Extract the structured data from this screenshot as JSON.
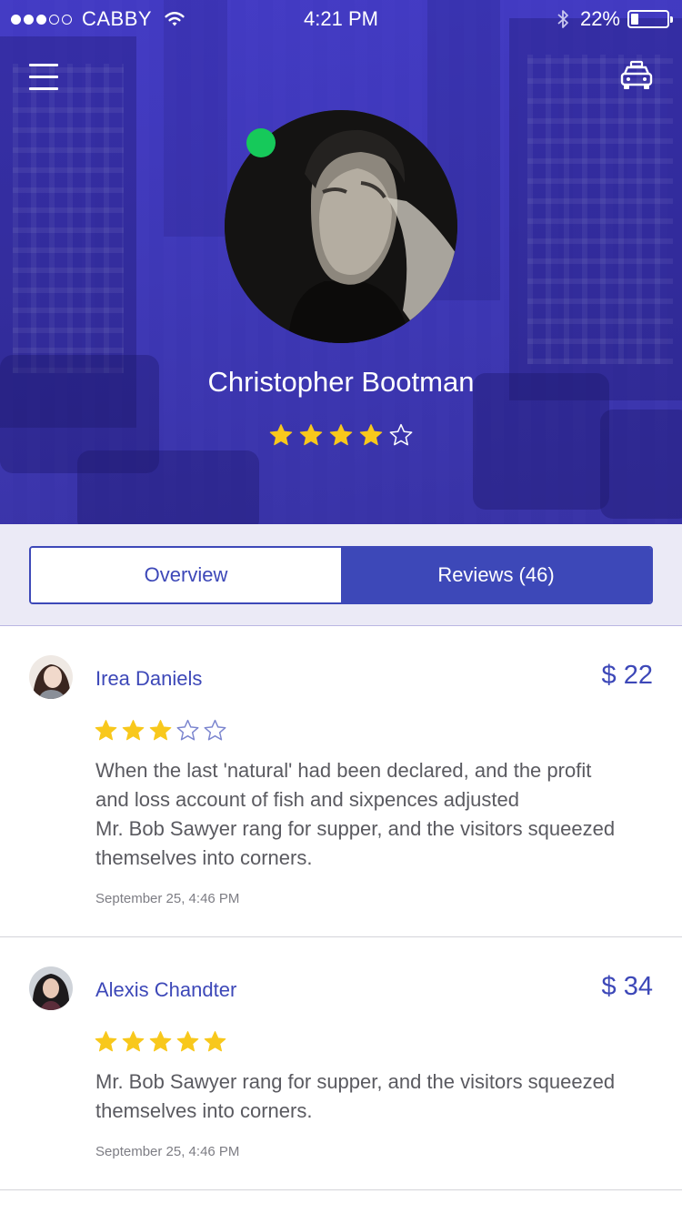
{
  "status_bar": {
    "signal": [
      true,
      true,
      true,
      false,
      false
    ],
    "carrier": "CABBY",
    "time": "4:21 PM",
    "battery": "22%",
    "battery_level": 0.22
  },
  "nav": {
    "menu_icon": "hamburger-menu-icon",
    "taxi_icon": "taxi-icon"
  },
  "profile": {
    "name": "Christopher Bootman",
    "rating": 4,
    "online": true,
    "online_color": "#16c95a"
  },
  "tabs": [
    {
      "label": "Overview",
      "active": false
    },
    {
      "label": "Reviews (46)",
      "active": true
    }
  ],
  "reviews": [
    {
      "name": "Irea Daniels",
      "price": "$ 22",
      "rating": 3,
      "text": "When the last 'natural' had been declared, and the profit\nand loss account of fish and sixpences adjusted\nMr. Bob Sawyer rang for supper, and the visitors squeezed\nthemselves into corners.",
      "date": "September 25, 4:46 PM"
    },
    {
      "name": "Alexis Chandter",
      "price": "$ 34",
      "rating": 5,
      "text": "Mr. Bob Sawyer rang for supper, and the visitors squeezed\nthemselves into corners.",
      "date": "September 25, 4:46 PM"
    }
  ],
  "colors": {
    "accent": "#3d48b8",
    "header": "#4a40c8",
    "star": "#f8c81c"
  }
}
